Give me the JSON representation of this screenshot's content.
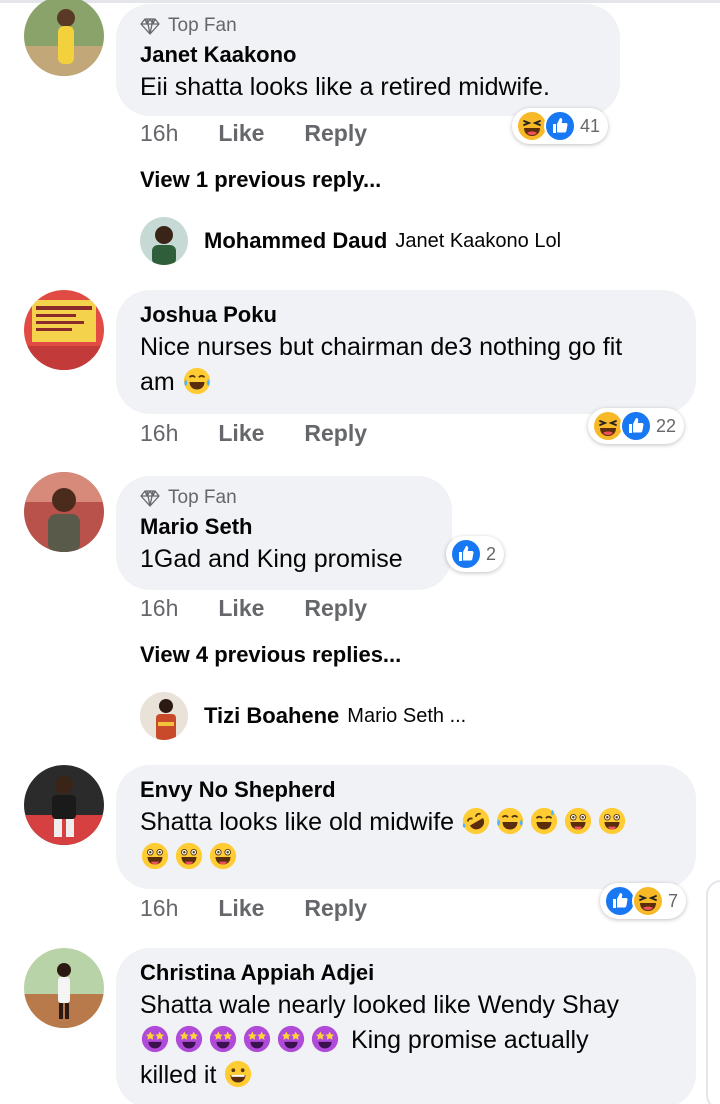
{
  "comments": [
    {
      "badge": "Top Fan",
      "author": "Janet Kaakono",
      "text": "Eii shatta looks like a retired midwife.",
      "time": "16h",
      "like": "Like",
      "reply": "Reply",
      "reaction_count": "41",
      "view_previous": "View 1 previous reply...",
      "latest_reply": {
        "author": "Mohammed Daud",
        "text": "Janet Kaakono  Lol"
      }
    },
    {
      "author": "Joshua Poku",
      "text_line1": "Nice nurses but chairman de3 nothing go fit",
      "text_line2": "am",
      "time": "16h",
      "like": "Like",
      "reply": "Reply",
      "reaction_count": "22"
    },
    {
      "badge": "Top Fan",
      "author": "Mario Seth",
      "text": "1Gad and King promise",
      "time": "16h",
      "like": "Like",
      "reply": "Reply",
      "reaction_count": "2",
      "view_previous": "View 4 previous replies...",
      "latest_reply": {
        "author": "Tizi Boahene",
        "text": "Mario Seth ..."
      }
    },
    {
      "author": "Envy No Shepherd",
      "text": "Shatta looks like old midwife",
      "time": "16h",
      "like": "Like",
      "reply": "Reply",
      "reaction_count": "7"
    },
    {
      "author": "Christina Appiah Adjei",
      "text_line1": "Shatta wale nearly looked like Wendy Shay",
      "text_line2": "King promise actually",
      "text_line3": "killed it"
    }
  ],
  "colors": {
    "like_blue": "#1877f2",
    "haha_yellow": "#f7b928",
    "bubble": "#f0f2f5",
    "muted_text": "#65676b"
  },
  "icons": [
    "diamond-icon",
    "like-reaction-icon",
    "haha-reaction-icon",
    "laughing-emoji",
    "grinning-emoji",
    "tongue-emoji",
    "star-struck-emoji"
  ]
}
